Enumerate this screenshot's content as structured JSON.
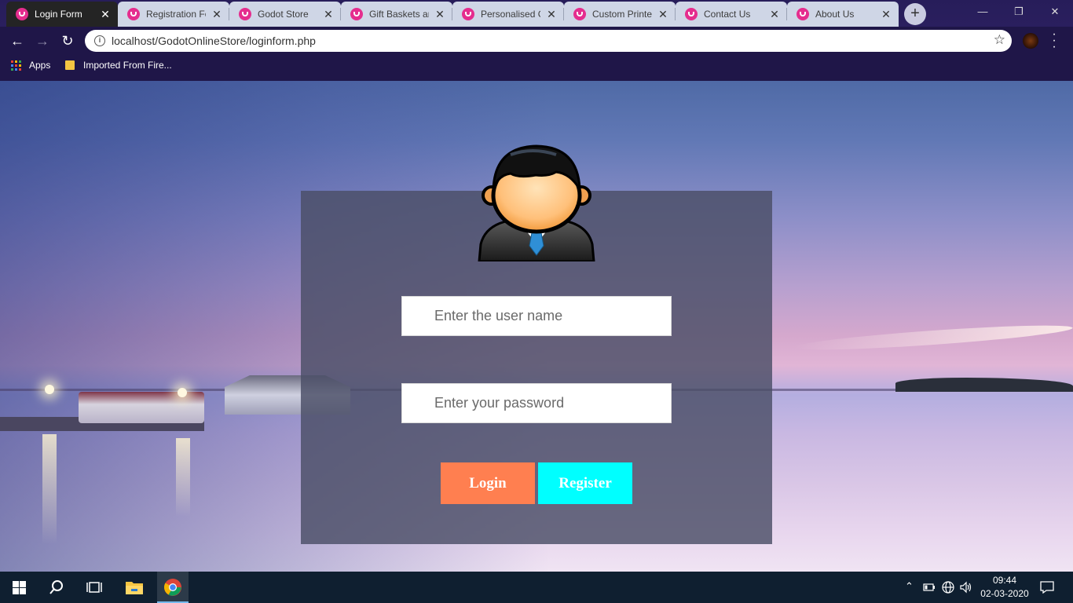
{
  "browser": {
    "tabs": [
      {
        "title": "Login Form",
        "active": true
      },
      {
        "title": "Registration Fo",
        "active": false
      },
      {
        "title": "Godot Store",
        "active": false
      },
      {
        "title": "Gift Baskets an",
        "active": false
      },
      {
        "title": "Personalised G",
        "active": false
      },
      {
        "title": "Custom Printe",
        "active": false
      },
      {
        "title": "Contact Us",
        "active": false
      },
      {
        "title": "About Us",
        "active": false
      }
    ],
    "new_tab_symbol": "+",
    "url": "localhost/GodotOnlineStore/loginform.php",
    "bookmarks": [
      {
        "label": "Apps",
        "icon": "apps-grid-icon"
      },
      {
        "label": "Imported From Fire...",
        "icon": "folder-icon"
      }
    ],
    "window_controls": {
      "minimize": "—",
      "restore": "❐",
      "close": "✕"
    }
  },
  "login": {
    "username_placeholder": "Enter the user name",
    "password_placeholder": "Enter your password",
    "login_label": "Login",
    "register_label": "Register",
    "login_color": "#ff7f50",
    "register_color": "#00ffff"
  },
  "taskbar": {
    "time": "09:44",
    "date": "02-03-2020"
  },
  "colors": {
    "favicon": "#e52d8e",
    "panel": "rgba(74,78,102,0.82)"
  }
}
